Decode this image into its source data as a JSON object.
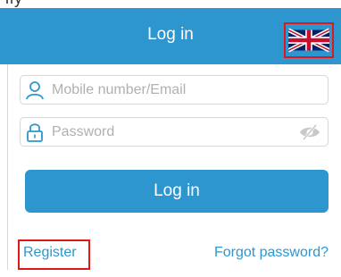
{
  "top_strip": {
    "text": "ily"
  },
  "header": {
    "title": "Log in",
    "language_icon": "uk-flag-icon"
  },
  "form": {
    "account_placeholder": "Mobile number/Email",
    "password_placeholder": "Password",
    "user_icon": "user-icon",
    "lock_icon": "lock-icon",
    "eye_icon": "eye-hidden-icon",
    "submit_label": "Log in"
  },
  "links": {
    "register": "Register",
    "forgot": "Forgot password?"
  },
  "colors": {
    "primary": "#2d96cf",
    "highlight": "#e01818",
    "border": "#d6d6d6",
    "placeholder": "#b0b0b0"
  }
}
